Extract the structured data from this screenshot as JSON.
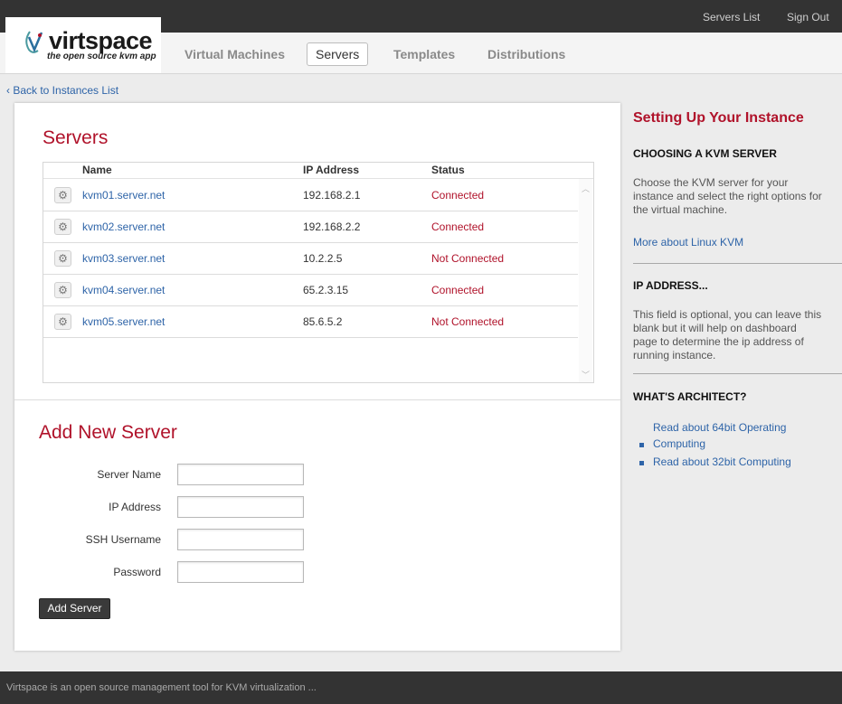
{
  "topbar": {
    "servers_list": "Servers List",
    "sign_out": "Sign Out"
  },
  "logo": {
    "word": "virtspace",
    "tagline": "the open source kvm app"
  },
  "nav": {
    "tabs": [
      {
        "label": "Virtual Machines"
      },
      {
        "label": "Servers",
        "active": true
      },
      {
        "label": "Templates"
      },
      {
        "label": "Distributions"
      }
    ]
  },
  "back_link": "‹ Back to Instances List",
  "servers": {
    "title": "Servers",
    "columns": [
      "Name",
      "IP Address",
      "Status"
    ],
    "rows": [
      {
        "name": "kvm01.server.net",
        "ip": "192.168.2.1",
        "status": "Connected"
      },
      {
        "name": "kvm02.server.net",
        "ip": "192.168.2.2",
        "status": "Connected"
      },
      {
        "name": "kvm03.server.net",
        "ip": "10.2.2.5",
        "status": "Not Connected"
      },
      {
        "name": "kvm04.server.net",
        "ip": "65.2.3.15",
        "status": "Connected"
      },
      {
        "name": "kvm05.server.net",
        "ip": "85.6.5.2",
        "status": "Not Connected"
      }
    ]
  },
  "add_server": {
    "title": "Add New Server",
    "fields": [
      {
        "label": "Server Name",
        "value": ""
      },
      {
        "label": "IP Address",
        "value": ""
      },
      {
        "label": "SSH Username",
        "value": ""
      },
      {
        "label": "Password",
        "value": ""
      }
    ],
    "button": "Add Server"
  },
  "sidebar": {
    "title": "Setting Up Your Instance",
    "sections": [
      {
        "heading": "CHOOSING A KVM SERVER",
        "text": "Choose the KVM server for your instance and select the right options for the virtual machine.",
        "link": "More about Linux KVM"
      },
      {
        "heading": "IP ADDRESS...",
        "text": "This field is optional, you can leave this blank but it will help on dashboard page to determine the ip address of running instance."
      },
      {
        "heading": "WHAT'S ARCHITECT?",
        "links": [
          "Read about 64bit Operating",
          "Computing",
          "Read about 32bit Computing"
        ]
      }
    ]
  },
  "footer": {
    "text": "Virtspace is an open source management tool for KVM virtualization ..."
  },
  "colors": {
    "accent": "#b0122a",
    "link": "#2e64a8",
    "dark_bar": "#333333"
  },
  "icons": {
    "row_action": "gear-icon",
    "logo_mark": "virtspace-logo-icon",
    "scroll_up": "chevron-up-icon",
    "scroll_down": "chevron-down-icon"
  }
}
